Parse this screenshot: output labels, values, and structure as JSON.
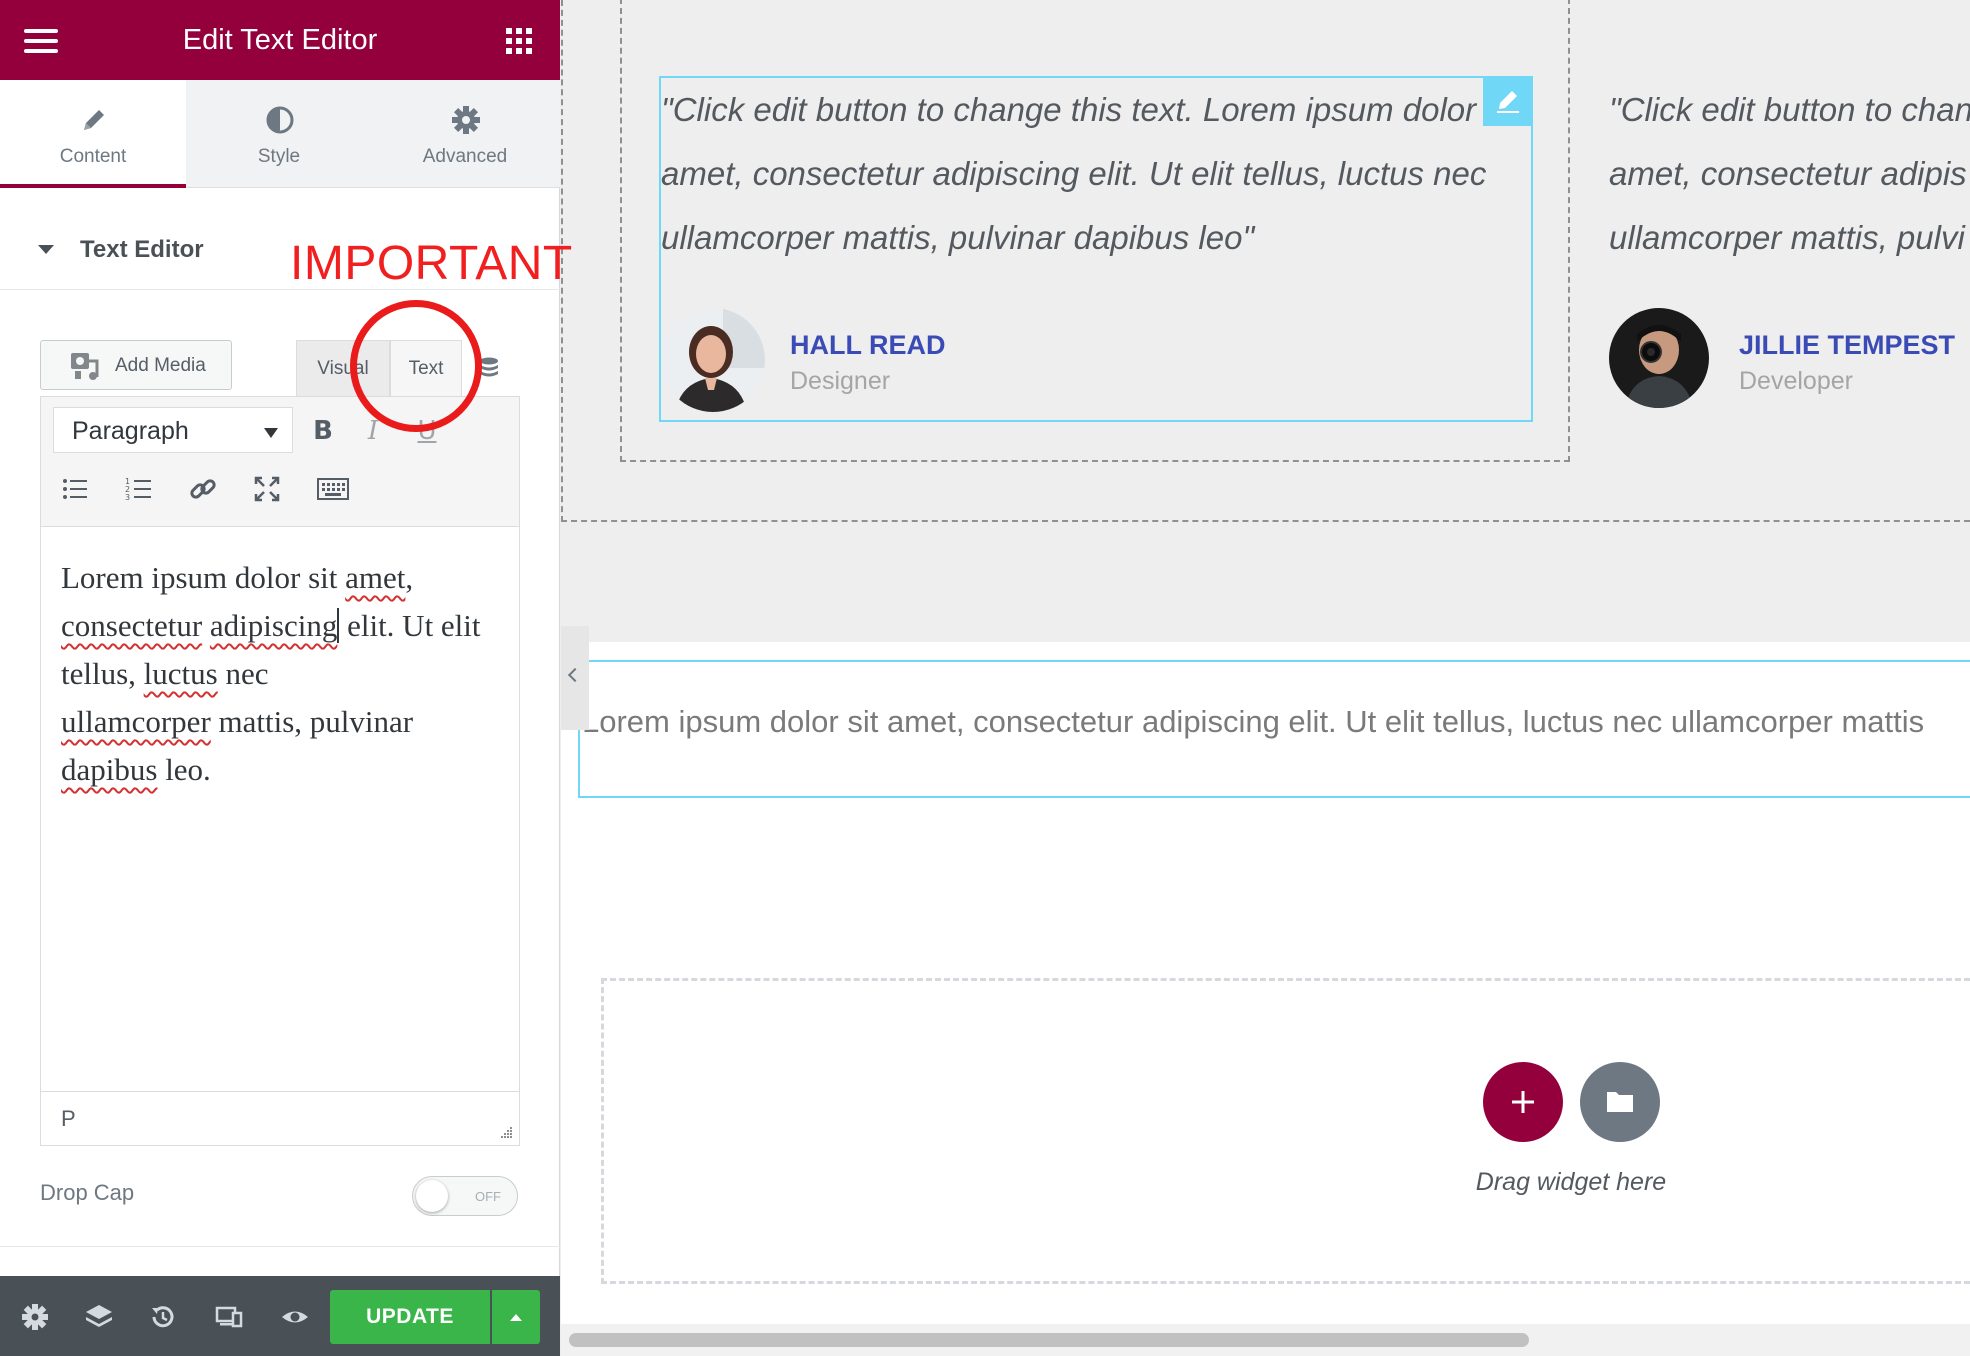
{
  "panel": {
    "title": "Edit Text Editor",
    "tabs": [
      {
        "label": "Content",
        "icon": "pencil-icon",
        "active": true
      },
      {
        "label": "Style",
        "icon": "half-circle-icon",
        "active": false
      },
      {
        "label": "Advanced",
        "icon": "gear-icon",
        "active": false
      }
    ],
    "section_title": "Text Editor",
    "annotation": "IMPORTANT",
    "add_media_label": "Add Media",
    "editor_tabs": {
      "visual": "Visual",
      "text": "Text",
      "active": "text"
    },
    "format_select": "Paragraph",
    "toolbar": {
      "bold": "B",
      "italic": "I",
      "underline": "U"
    },
    "content": {
      "w1": "Lorem ipsum dolor sit ",
      "w2": "amet",
      "w3": ",",
      "w4": "consectetur",
      "w5": " ",
      "w6": "adipiscing",
      "w7": " elit. Ut elit tellus, ",
      "w8": "luctus",
      "w9": " nec",
      "w10": "ullamcorper",
      "w11": " mattis, pulvinar",
      "w12": "dapibus",
      "w13": " leo."
    },
    "status_path": "P",
    "drop_cap_label": "Drop Cap",
    "drop_cap_state": "OFF",
    "update_label": "UPDATE"
  },
  "canvas": {
    "testimonials": [
      {
        "line1": "\"Click edit button to change this text. Lorem ipsum dolor",
        "line2": "amet, consectetur adipiscing elit. Ut elit tellus, luctus nec",
        "line3": "ullamcorper mattis, pulvinar dapibus leo\"",
        "name": "HALL READ",
        "role": "Designer"
      },
      {
        "line1": "\"Click edit button to chan",
        "line2": "amet, consectetur adipis",
        "line3": "ullamcorper mattis, pulvi",
        "name": "JILLIE TEMPEST",
        "role": "Developer"
      }
    ],
    "text_widget": "Lorem ipsum dolor sit amet, consectetur adipiscing elit. Ut elit tellus, luctus nec ullamcorper mattis",
    "drag_widget_label": "Drag widget here"
  },
  "colors": {
    "brand": "#93003c",
    "update_green": "#39b54a",
    "selection_blue": "#71d7f7",
    "name_blue": "#3a4bb6",
    "annotation_red": "#ea1b1b"
  }
}
